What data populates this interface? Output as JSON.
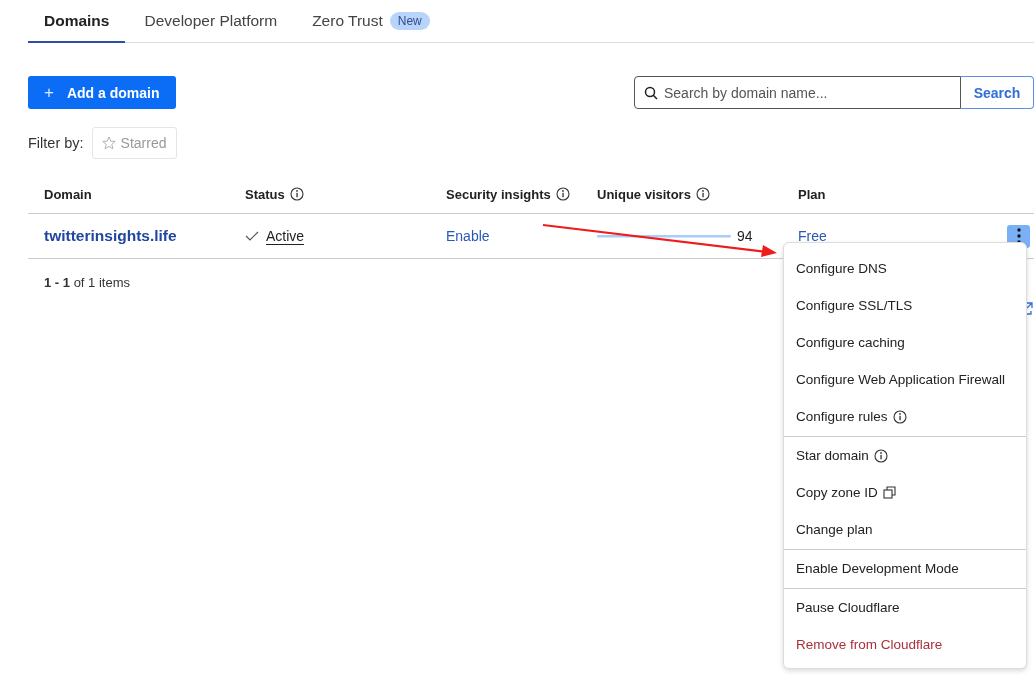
{
  "tabs": [
    {
      "label": "Domains",
      "selected": true
    },
    {
      "label": "Developer Platform",
      "selected": false
    },
    {
      "label": "Zero Trust",
      "selected": false,
      "badge": "New"
    }
  ],
  "add_button": {
    "icon": "+",
    "label": "Add a domain"
  },
  "search": {
    "placeholder": "Search by domain name...",
    "button": "Search"
  },
  "filter": {
    "label": "Filter by:",
    "options": [
      {
        "label": "Starred",
        "selected": false
      }
    ]
  },
  "table": {
    "columns": [
      {
        "label": "Domain",
        "kind": "plain"
      },
      {
        "label": "Status",
        "kind": "info"
      },
      {
        "label": "Security insights",
        "kind": "info"
      },
      {
        "label": "Unique visitors",
        "kind": "info"
      },
      {
        "label": "Plan",
        "kind": "plain"
      }
    ],
    "rows": [
      {
        "domain": "twitterinsights.life",
        "status": "Active",
        "security": "Enable",
        "visitors": "94",
        "plan": "Free"
      }
    ]
  },
  "pagination": {
    "range": "1 - 1",
    "total": "of 1 items"
  },
  "menu": {
    "groups": [
      [
        {
          "label": "Configure DNS",
          "kind": "plain"
        },
        {
          "label": "Configure SSL/TLS",
          "kind": "plain"
        },
        {
          "label": "Configure caching",
          "kind": "plain"
        },
        {
          "label": "Configure Web Application Firewall",
          "kind": "plain"
        },
        {
          "label": "Configure rules",
          "kind": "info"
        }
      ],
      [
        {
          "label": "Star domain",
          "kind": "info"
        },
        {
          "label": "Copy zone ID",
          "kind": "copy"
        },
        {
          "label": "Change plan",
          "kind": "plain"
        }
      ],
      [
        {
          "label": "Enable Development Mode",
          "kind": "plain"
        }
      ],
      [
        {
          "label": "Pause Cloudflare",
          "kind": "plain"
        },
        {
          "label": "Remove from Cloudflare",
          "kind": "danger"
        }
      ]
    ]
  }
}
